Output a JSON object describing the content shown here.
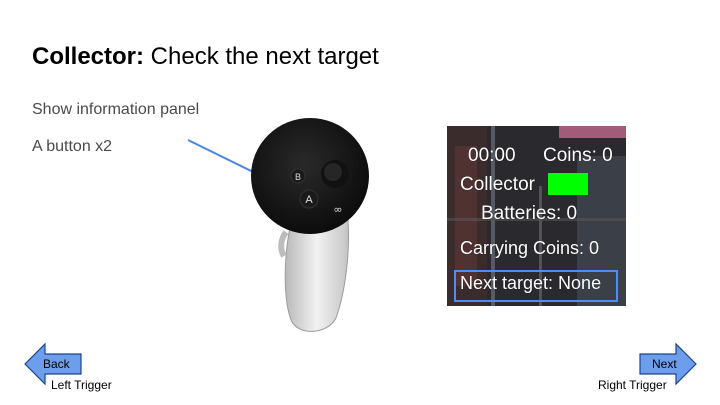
{
  "title": {
    "bold": "Collector:",
    "rest": " Check the next target"
  },
  "instructions": [
    "Show information panel",
    "A button x2"
  ],
  "controller": {
    "buttons": [
      "B",
      "A",
      "∞"
    ]
  },
  "panel": {
    "time": "00:00",
    "coins": "Coins: 0",
    "collector": "Collector",
    "collector_color": "#00ff00",
    "batteries": "Batteries: 0",
    "carrying": "Carrying Coins: 0",
    "next_target": "Next target: None",
    "highlight_color": "#4c8dfa"
  },
  "nav": {
    "back_label": "Back",
    "back_trigger": "Left Trigger",
    "next_label": "Next",
    "next_trigger": "Right Trigger",
    "arrow_color": "#6d9eeb"
  },
  "pointer_color": "#4a86e8"
}
